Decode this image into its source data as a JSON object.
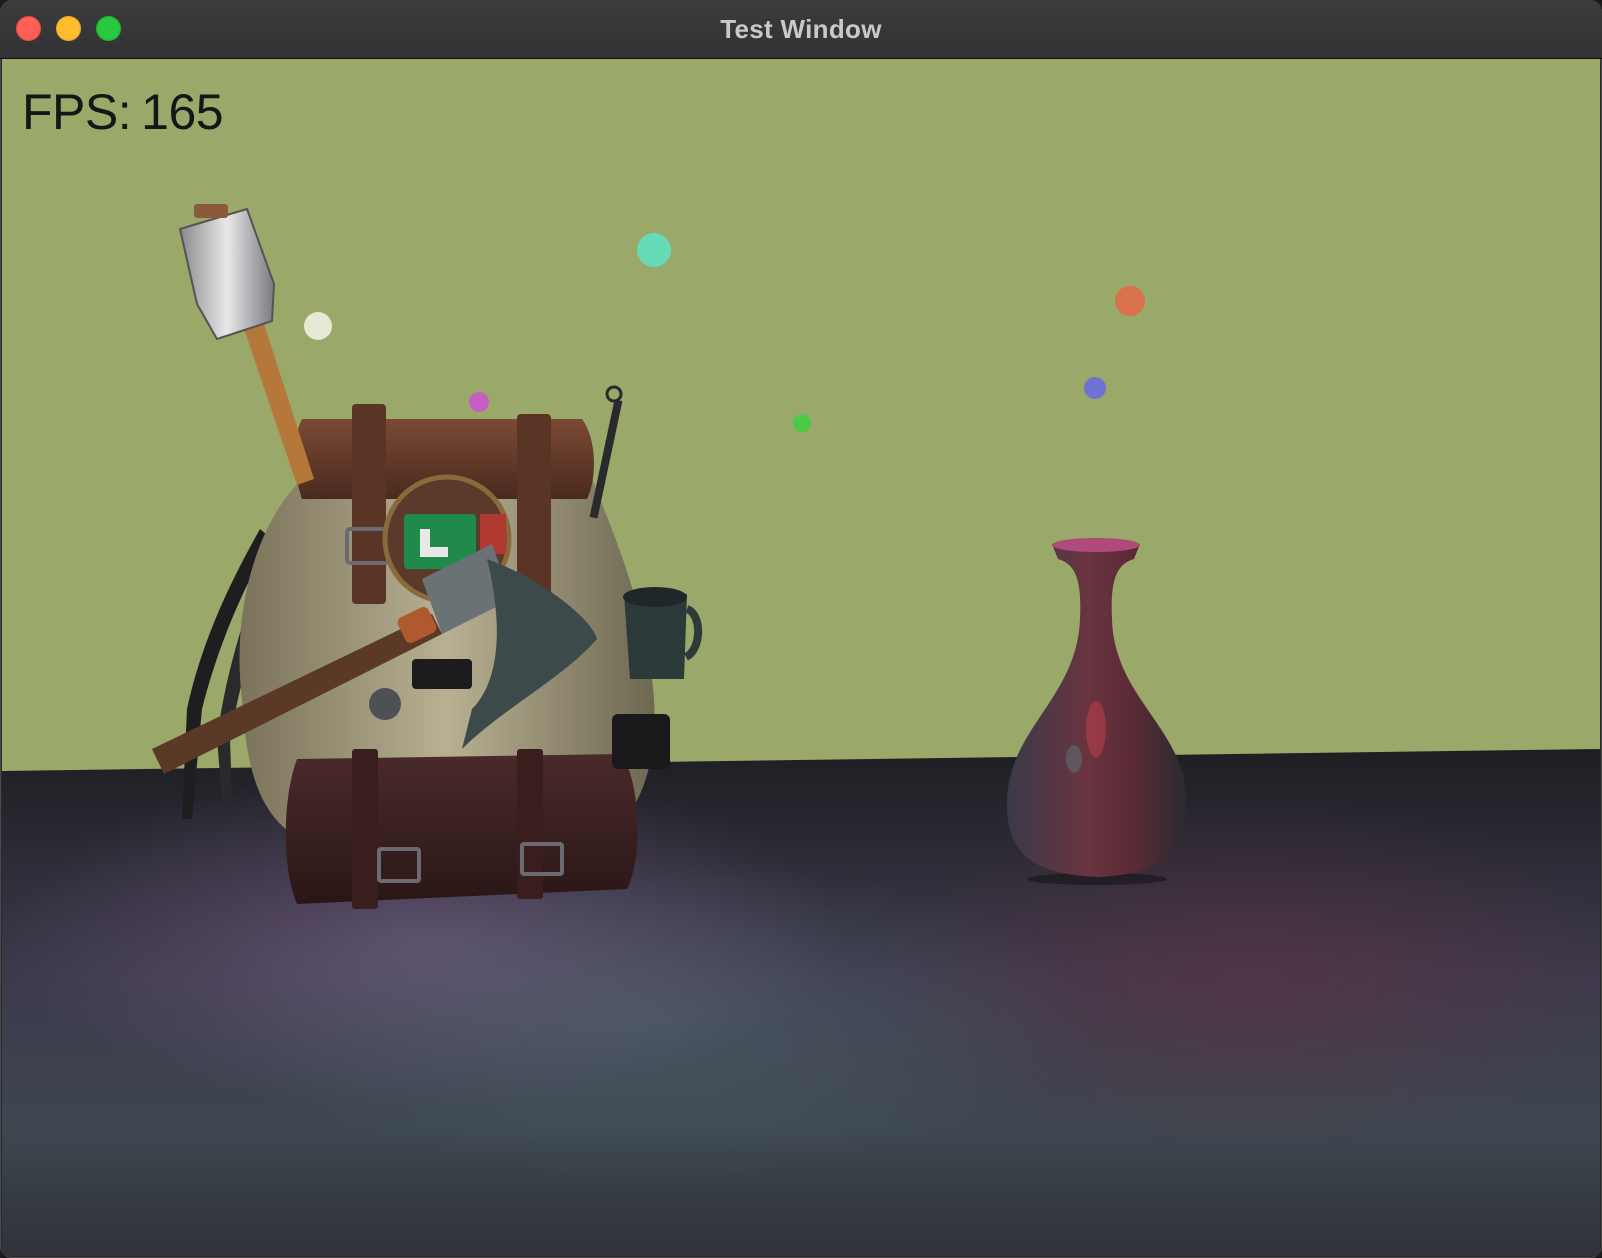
{
  "window": {
    "title": "Test Window"
  },
  "hud": {
    "fps_label": "FPS:",
    "fps_value": "165"
  },
  "scene": {
    "objects": [
      "backpack-model",
      "vase-model"
    ],
    "wall_color": "#9aa869",
    "floor_color": "#2b2a33",
    "point_lights": [
      {
        "color": "#e8e8d6"
      },
      {
        "color": "#5fe0c0"
      },
      {
        "color": "#cc55cc"
      },
      {
        "color": "#44cc44"
      },
      {
        "color": "#e06a4a"
      },
      {
        "color": "#6a6adf"
      }
    ]
  }
}
